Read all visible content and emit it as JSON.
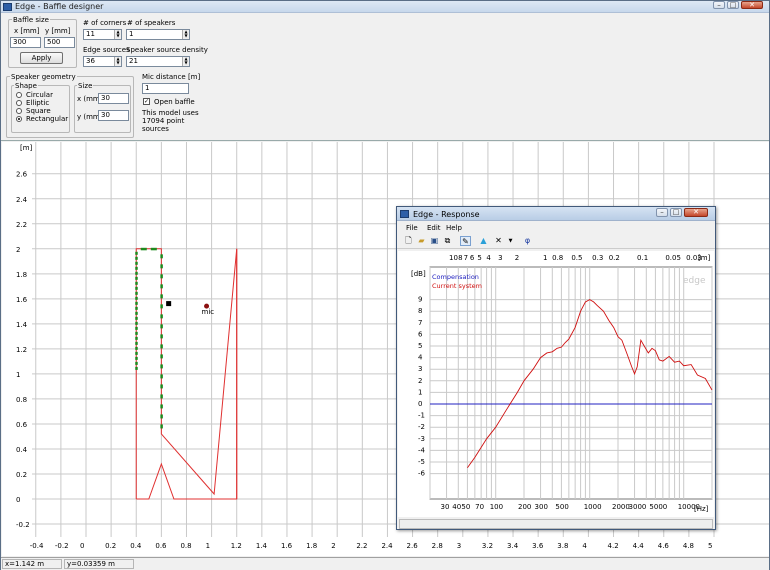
{
  "window": {
    "title": "Edge - Baffle designer"
  },
  "baffle_size": {
    "group": "Baffle size",
    "x_label": "x [mm]",
    "y_label": "y [mm]",
    "x_value": "300",
    "y_value": "500",
    "apply": "Apply"
  },
  "corners": {
    "label": "# of corners",
    "value": "11"
  },
  "speakers": {
    "label": "# of speakers",
    "value": "1"
  },
  "edge_sources": {
    "label": "Edge sources",
    "value": "36"
  },
  "speaker_density": {
    "label": "Speaker source density",
    "value": "21"
  },
  "speaker_geometry": {
    "group": "Speaker geometry",
    "shape_group": "Shape",
    "shapes": [
      "Circular",
      "Elliptic",
      "Square",
      "Rectangular"
    ],
    "selected_shape": "Rectangular",
    "size_group": "Size",
    "x_label": "x (mm)",
    "y_label": "y (mm)",
    "x_value": "30",
    "y_value": "30"
  },
  "mic": {
    "label": "Mic distance [m]",
    "value": "1"
  },
  "open_baffle": {
    "label": "Open baffle",
    "checked": true
  },
  "model_info": [
    "This model uses",
    "17094 point",
    "sources"
  ],
  "layout_plot": {
    "unit": "[m]",
    "y_ticks": [
      "-0.2",
      "0",
      "0.2",
      "0.4",
      "0.6",
      "0.8",
      "1",
      "1.2",
      "1.4",
      "1.6",
      "1.8",
      "2",
      "2.2",
      "2.4",
      "2.6"
    ],
    "x_ticks": [
      "-0.4",
      "-0.2",
      "0",
      "0.2",
      "0.4",
      "0.6",
      "0.8",
      "1",
      "1.2",
      "1.4",
      "1.6",
      "1.8",
      "2",
      "2.2",
      "2.4",
      "2.6",
      "2.8",
      "3",
      "3.2",
      "3.4",
      "3.6",
      "3.8",
      "4",
      "4.2",
      "4.4",
      "4.6",
      "4.8",
      "5"
    ],
    "mic_label": "mic",
    "colors": {
      "baffle": "#e03030",
      "edge": "#1e8a1e",
      "grid": "#c9c9c9"
    }
  },
  "status": {
    "x": "x=1.142 m",
    "y": "y=0.03359 m"
  },
  "response": {
    "title": "Edge - Response",
    "menu": [
      "File",
      "Edit",
      "Help"
    ],
    "tools": [
      "new-icon",
      "open-icon",
      "save-icon",
      "copy-icon",
      "marker-icon",
      "paint-icon",
      "close-x-icon",
      "dropdown-icon",
      "phase-icon"
    ],
    "top_axis": [
      "10",
      "8",
      "7",
      "6",
      "5",
      "4",
      "3",
      "2",
      "1",
      "0.8",
      "0.5",
      "0.3",
      "0.2",
      "0.1",
      "0.05",
      "0.03"
    ],
    "top_unit": "[m]",
    "db_unit": "[dB]",
    "db_ticks": [
      "9",
      "8",
      "7",
      "6",
      "5",
      "4",
      "3",
      "2",
      "1",
      "0",
      "-1",
      "-2",
      "-3",
      "-4",
      "-5",
      "-6"
    ],
    "hz_ticks": [
      "30",
      "40",
      "50",
      "70",
      "100",
      "200",
      "300",
      "500",
      "1000",
      "2000",
      "3000",
      "5000",
      "10000"
    ],
    "hz_unit": "[Hz]",
    "legend": [
      "Compensation",
      "Current system"
    ],
    "watermark": "edge",
    "colors": {
      "compensation": "#2020c0",
      "current": "#d01010"
    }
  }
}
